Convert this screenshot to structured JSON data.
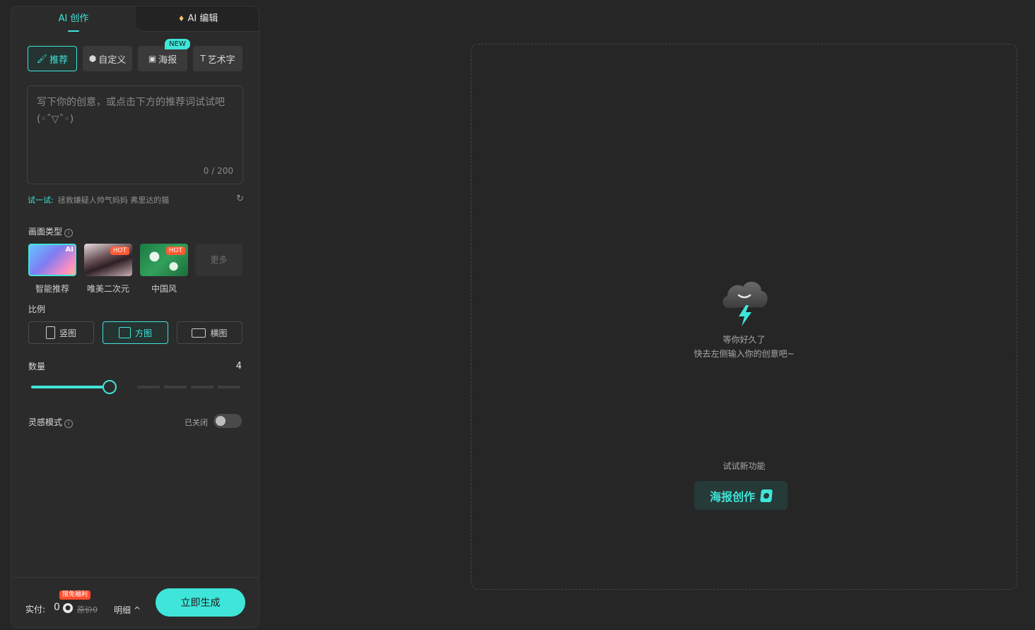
{
  "tabs": {
    "create_label": "AI 创作",
    "edit_label": "AI 编辑"
  },
  "modes": {
    "recommend": "推荐",
    "custom": "自定义",
    "poster": "海报",
    "art_text": "艺术字",
    "new_badge": "NEW"
  },
  "prompt": {
    "placeholder": "写下你的创意，或点击下方的推荐词试试吧(◦ˆ▽ˆ◦)",
    "counter": "0 / 200"
  },
  "try": {
    "label": "试一试:",
    "suggestions": "拯救嫌疑人帅气妈妈   弗里达的猫"
  },
  "style": {
    "title": "画面类型",
    "items": [
      {
        "label": "智能推荐",
        "tag": "AI"
      },
      {
        "label": "唯美二次元",
        "tag": "HOT"
      },
      {
        "label": "中国风",
        "tag": "HOT"
      }
    ],
    "more": "更多"
  },
  "ratio": {
    "title": "比例",
    "options": [
      "竖图",
      "方图",
      "横图"
    ],
    "selected": "方图"
  },
  "quantity": {
    "title": "数量",
    "value": "4",
    "fraction": 0.375
  },
  "inspiration": {
    "title": "灵感模式",
    "status": "已关闭"
  },
  "footer": {
    "pay_label": "实付:",
    "amount": "0",
    "original_price": "原价0",
    "promo": "限免福利",
    "detail": "明细 ^",
    "generate": "立即生成"
  },
  "canvas": {
    "empty_title": "等你好久了",
    "empty_subtitle": "快去左侧输入你的创意吧~",
    "new_feature_label": "试试新功能",
    "poster_button": "海报创作"
  },
  "colors": {
    "accent": "#3fe5d9",
    "background": "#262626",
    "panel": "#2b2b2b"
  }
}
